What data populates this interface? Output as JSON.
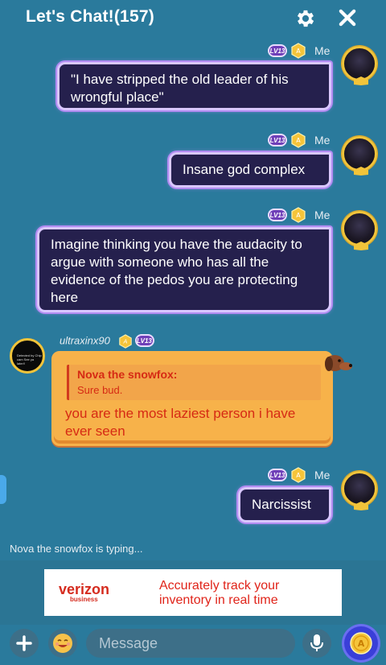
{
  "header": {
    "title": "Let's Chat!(157)"
  },
  "me_label": "Me",
  "level_badge": "LV13",
  "messages": [
    {
      "sender": "Me",
      "text": "\"I have stripped the old leader of his wrongful place\""
    },
    {
      "sender": "Me",
      "text": "Insane god complex"
    },
    {
      "sender": "Me",
      "text": "Imagine thinking you have the audacity to argue with someone who has all the evidence of the pedos you are protecting here"
    },
    {
      "sender": "ultraxinx90",
      "quote_name": "Nova the snowfox:",
      "quote_text": "Sure bud.",
      "text": "you are the most laziest person i have ever seen",
      "avatar_text": "Detected by Chip cam See ya later!!"
    },
    {
      "sender": "Me",
      "text": "Narcissist"
    }
  ],
  "typing_indicator": "Nova the snowfox is typing...",
  "ad": {
    "brand": "verizon",
    "brand_sub": "business",
    "text": "Accurately track your inventory in real time"
  },
  "composer": {
    "placeholder": "Message"
  },
  "colors": {
    "background": "#2a7a9c",
    "me_bubble": "#25204d",
    "me_bubble_border": "#d9c7ff",
    "other_bubble": "#f7b24a",
    "other_text": "#d62a14"
  }
}
